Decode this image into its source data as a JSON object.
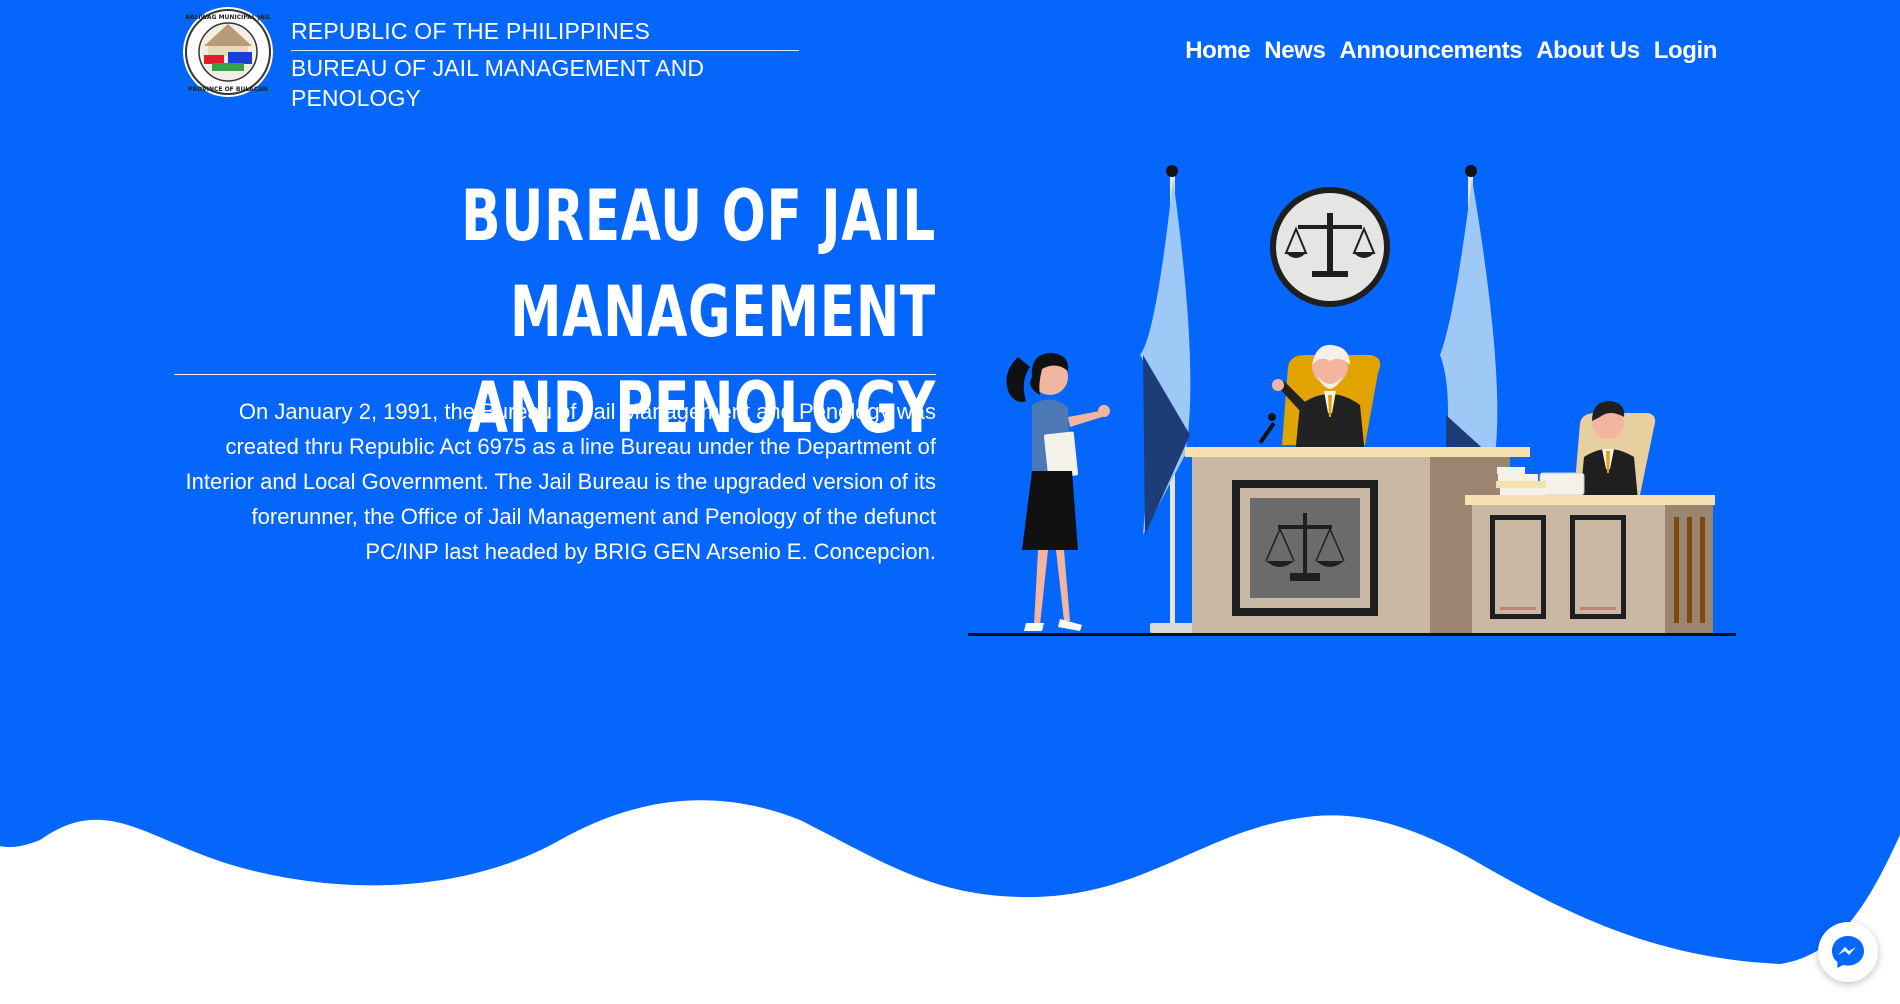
{
  "header": {
    "seal_text": "BALIWAG MUNICIPAL JAIL · PROVINCE OF BULACAN",
    "brand_line1": "REPUBLIC OF THE PHILIPPINES",
    "brand_line2": "BUREAU OF JAIL MANAGEMENT AND PENOLOGY"
  },
  "nav": {
    "items": [
      {
        "label": "Home"
      },
      {
        "label": "News"
      },
      {
        "label": "Announcements"
      },
      {
        "label": "About Us"
      },
      {
        "label": "Login"
      }
    ]
  },
  "hero": {
    "title_line1": "BUREAU OF JAIL",
    "title_line2": "MANAGEMENT AND PENOLOGY",
    "description": "On January 2, 1991, the Bureau of Jail Management and Penology was created thru Republic Act 6975 as a line Bureau under the Department of Interior and Local Government. The Jail Bureau is the upgraded version of its forerunner, the Office of Jail Management and Penology of the defunct PC/INP last headed by BRIG GEN Arsenio E. Concepcion."
  },
  "colors": {
    "primary": "#0466fb",
    "background": "#ffffff",
    "desk": "#c8b8a4",
    "desk_shadow": "#9b8571",
    "flag": "#9ec8f6",
    "flag_dark": "#1c3d78"
  },
  "icons": {
    "seal": "bjmp-seal-icon",
    "messenger": "messenger-icon"
  }
}
